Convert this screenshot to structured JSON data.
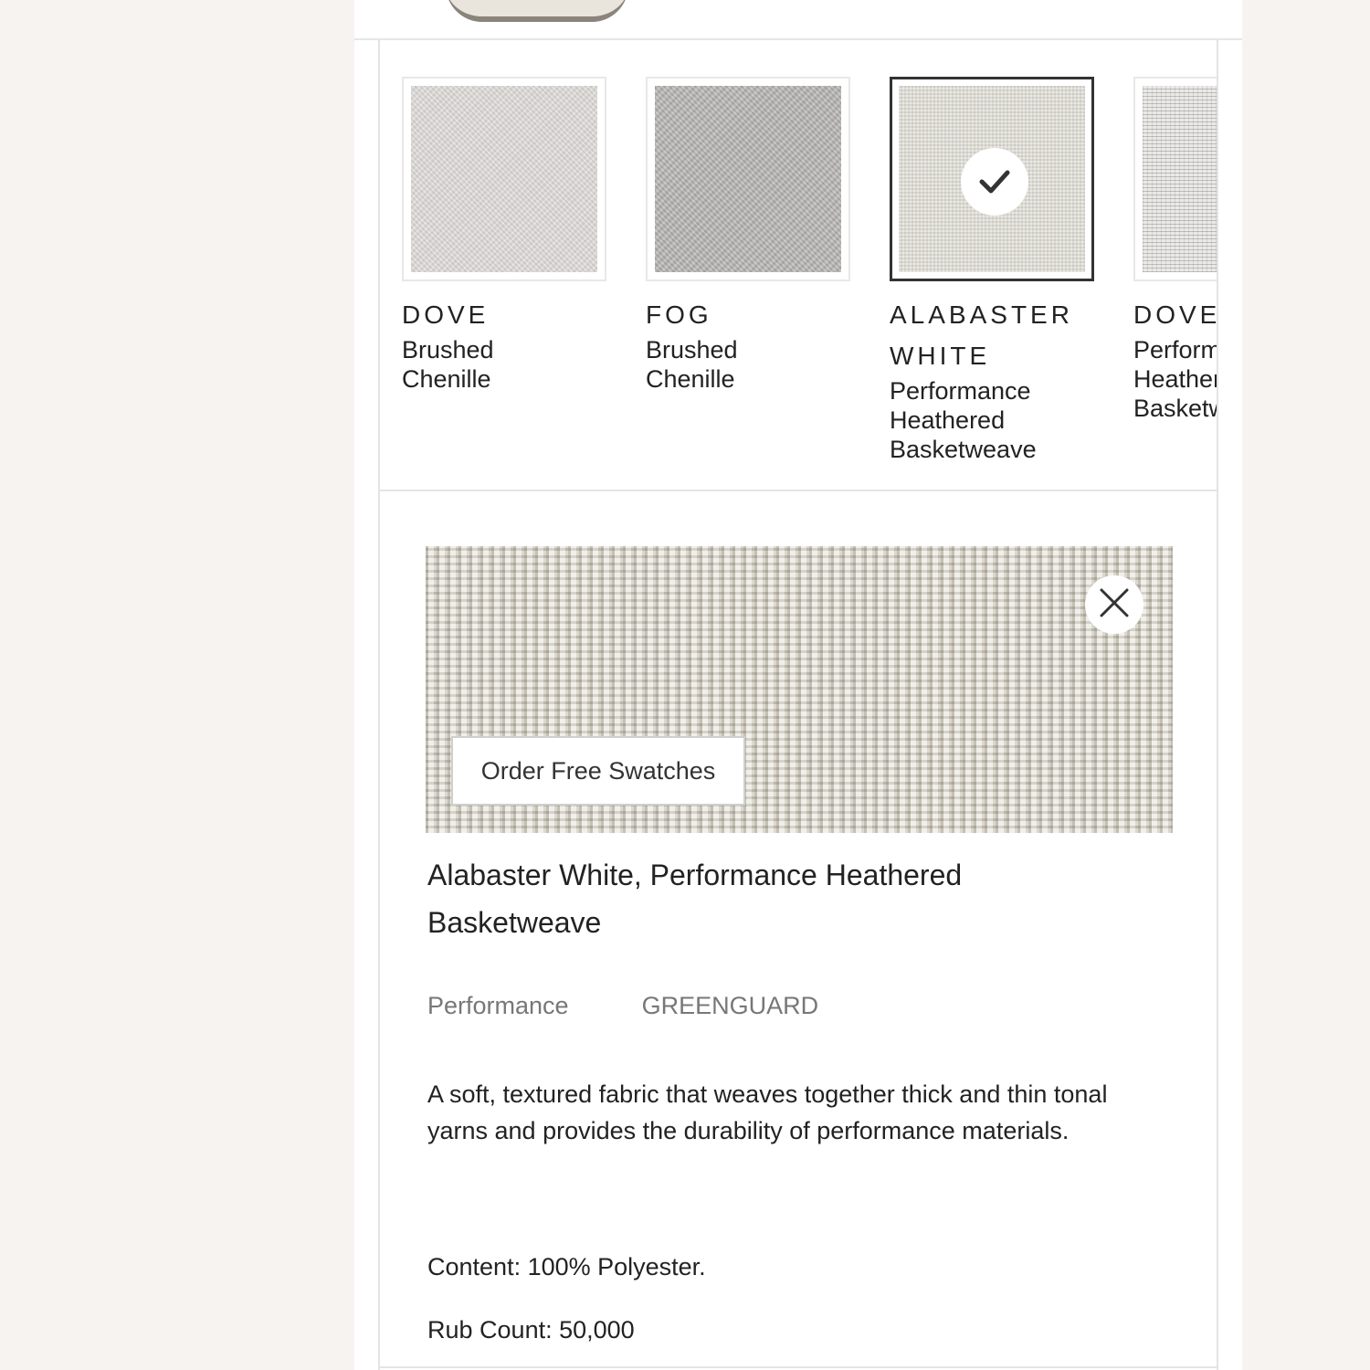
{
  "swatches": [
    {
      "name": "DOVE",
      "desc": "Brushed Chenille",
      "selected": false
    },
    {
      "name": "FOG",
      "desc": "Brushed Chenille",
      "selected": false
    },
    {
      "name": "ALABASTER WHITE",
      "desc": "Performance Heathered Basketweave",
      "selected": true
    },
    {
      "name": "DOVE",
      "desc": "Performance Heathered Basketweave",
      "selected": false
    }
  ],
  "detail": {
    "order_button": "Order Free Swatches",
    "title": "Alabaster White, Performance Heathered Basketweave",
    "tags": [
      "Performance",
      "GREENGUARD"
    ],
    "description": "A soft, textured fabric that weaves together thick and thin tonal yarns and provides the durability of performance materials.",
    "content": "Content: 100% Polyester.",
    "rub_count": "Rub Count: 50,000"
  },
  "icons": {
    "check": "check-icon",
    "close": "close-icon"
  }
}
